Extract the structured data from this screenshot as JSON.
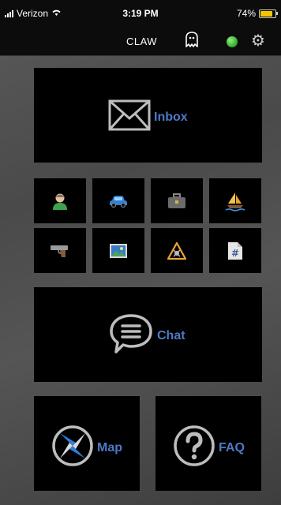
{
  "status_bar": {
    "carrier": "Verizon",
    "time": "3:19 PM",
    "battery": "74%",
    "battery_level": 0.74
  },
  "header": {
    "title": "CLAW",
    "status_color": "#2fa82f"
  },
  "tiles": {
    "inbox_label": "Inbox",
    "chat_label": "Chat",
    "map_label": "Map",
    "faq_label": "FAQ",
    "label_color": "#4d79c7"
  },
  "category_icons": [
    "person-icon",
    "car-icon",
    "briefcase-icon",
    "sailboat-icon",
    "gun-icon",
    "picture-icon",
    "warning-icon",
    "document-hash-icon"
  ]
}
